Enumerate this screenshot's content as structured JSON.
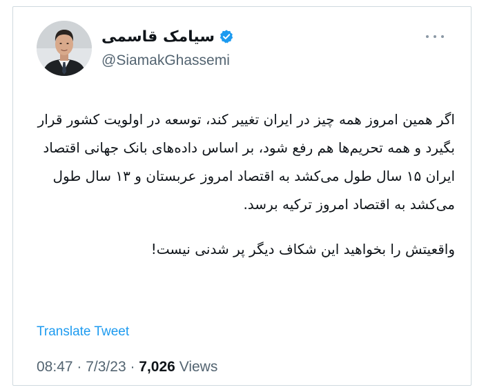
{
  "author": {
    "display_name": "سیامک قاسمی",
    "handle": "@SiamakGhassemi",
    "verified": true,
    "avatar": "avatar-portrait"
  },
  "tweet": {
    "paragraph_1": "اگر همین امروز همه چیز در ایران تغییر کند، توسعه در اولویت کشور قرار بگیرد و همه تحریم‌ها هم رفع شود، بر اساس داده‌های بانک جهانی اقتصاد ایران ۱۵ سال طول می‌کشد به اقتصاد امروز عربستان و ۱۳ سال طول می‌کشد به اقتصاد امروز ترکیه برسد.",
    "paragraph_2": "واقعیتش را بخواهید این شکاف دیگر پر شدنی نیست!"
  },
  "translate_label": "Translate Tweet",
  "meta": {
    "time": "08:47",
    "separator": " · ",
    "date": "7/3/23",
    "views_count": "7,026",
    "views_label": "Views"
  },
  "icons": {
    "verified": "verified-badge-icon",
    "more": "more-options-icon"
  },
  "colors": {
    "accent": "#1d9bf0",
    "text": "#0f1419",
    "secondary": "#536471",
    "border": "#cfd9de"
  }
}
